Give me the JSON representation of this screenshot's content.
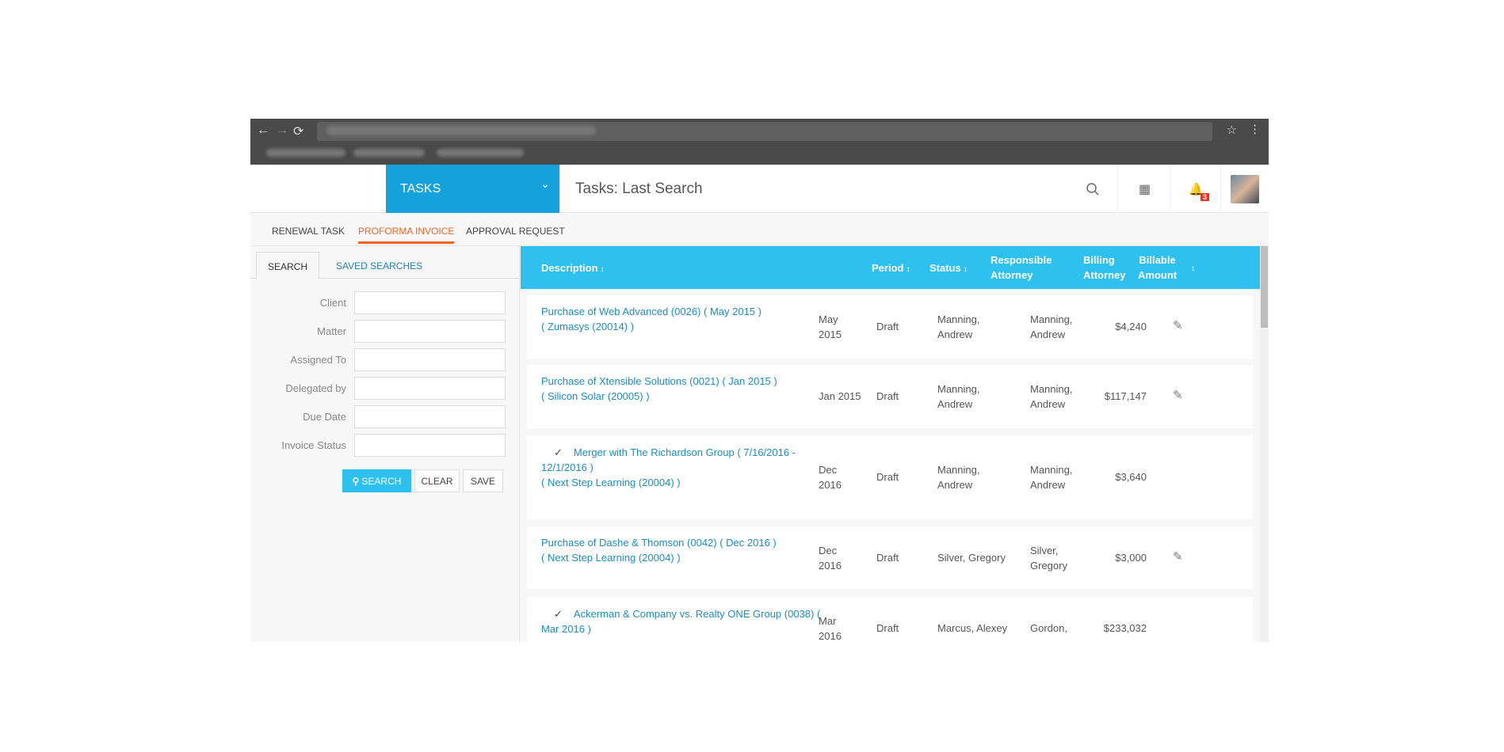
{
  "header": {
    "menu_label": "TASKS",
    "title": "Tasks: Last Search",
    "notification_count": "3"
  },
  "tabs": [
    {
      "label": "RENEWAL TASK"
    },
    {
      "label": "PROFORMA INVOICE",
      "active": true
    },
    {
      "label": "APPROVAL REQUEST"
    }
  ],
  "search_panel": {
    "tabs": [
      {
        "label": "SEARCH"
      },
      {
        "label": "SAVED SEARCHES"
      }
    ],
    "fields": [
      {
        "label": "Client",
        "value": ""
      },
      {
        "label": "Matter",
        "value": ""
      },
      {
        "label": "Assigned To",
        "value": ""
      },
      {
        "label": "Delegated by",
        "value": ""
      },
      {
        "label": "Due Date",
        "value": ""
      },
      {
        "label": "Invoice Status",
        "value": ""
      }
    ],
    "buttons": {
      "search": "SEARCH",
      "clear": "CLEAR",
      "save": "SAVE"
    }
  },
  "table": {
    "columns": {
      "description": "Description",
      "period": "Period",
      "status": "Status",
      "responsible_1": "Responsible",
      "responsible_2": "Attorney",
      "billing_1": "Billing",
      "billing_2": "Attorney",
      "amount_1": "Billable",
      "amount_2": "Amount"
    },
    "rows": [
      {
        "checked": false,
        "line1": "Purchase of Web Advanced (0026) ( May 2015 )",
        "line2": "( Zumasys (20014) )",
        "period_1": "May",
        "period_2": "2015",
        "status": "Draft",
        "responsible_1": "Manning,",
        "responsible_2": "Andrew",
        "billing_1": "Manning,",
        "billing_2": "Andrew",
        "amount": "$4,240",
        "editable": true
      },
      {
        "checked": false,
        "line1": "Purchase of Xtensible Solutions (0021) ( Jan 2015 )",
        "line2": "( Silicon Solar (20005) )",
        "period_1": "Jan 2015",
        "period_2": "",
        "status": "Draft",
        "responsible_1": "Manning,",
        "responsible_2": "Andrew",
        "billing_1": "Manning,",
        "billing_2": "Andrew",
        "amount": "$117,147",
        "editable": true
      },
      {
        "checked": true,
        "line1": "Merger with The Richardson Group ( 7/16/2016 -",
        "line1b": "12/1/2016 )",
        "line2": "( Next Step Learning (20004) )",
        "period_1": "Dec",
        "period_2": "2016",
        "status": "Draft",
        "responsible_1": "Manning,",
        "responsible_2": "Andrew",
        "billing_1": "Manning,",
        "billing_2": "Andrew",
        "amount": "$3,640",
        "editable": false
      },
      {
        "checked": false,
        "line1": "Purchase of Dashe & Thomson (0042) ( Dec 2016 )",
        "line2": "( Next Step Learning (20004) )",
        "period_1": "Dec",
        "period_2": "2016",
        "status": "Draft",
        "responsible_1": "Silver, Gregory",
        "responsible_2": "",
        "billing_1": "Silver,",
        "billing_2": "Gregory",
        "amount": "$3,000",
        "editable": true
      },
      {
        "checked": true,
        "line1": "Ackerman & Company vs. Realty ONE Group (0038) (",
        "line1b": "Mar 2016 )",
        "line2": "",
        "period_1": "Mar",
        "period_2": "2016",
        "status": "Draft",
        "responsible_1": "Marcus, Alexey",
        "responsible_2": "",
        "billing_1": "Gordon,",
        "billing_2": "",
        "amount": "$233,032",
        "editable": false
      }
    ]
  },
  "colors": {
    "accent": "#2ec0ef",
    "menu": "#13a2dc",
    "active_tab": "#f26522",
    "link": "#1a8cc6"
  }
}
